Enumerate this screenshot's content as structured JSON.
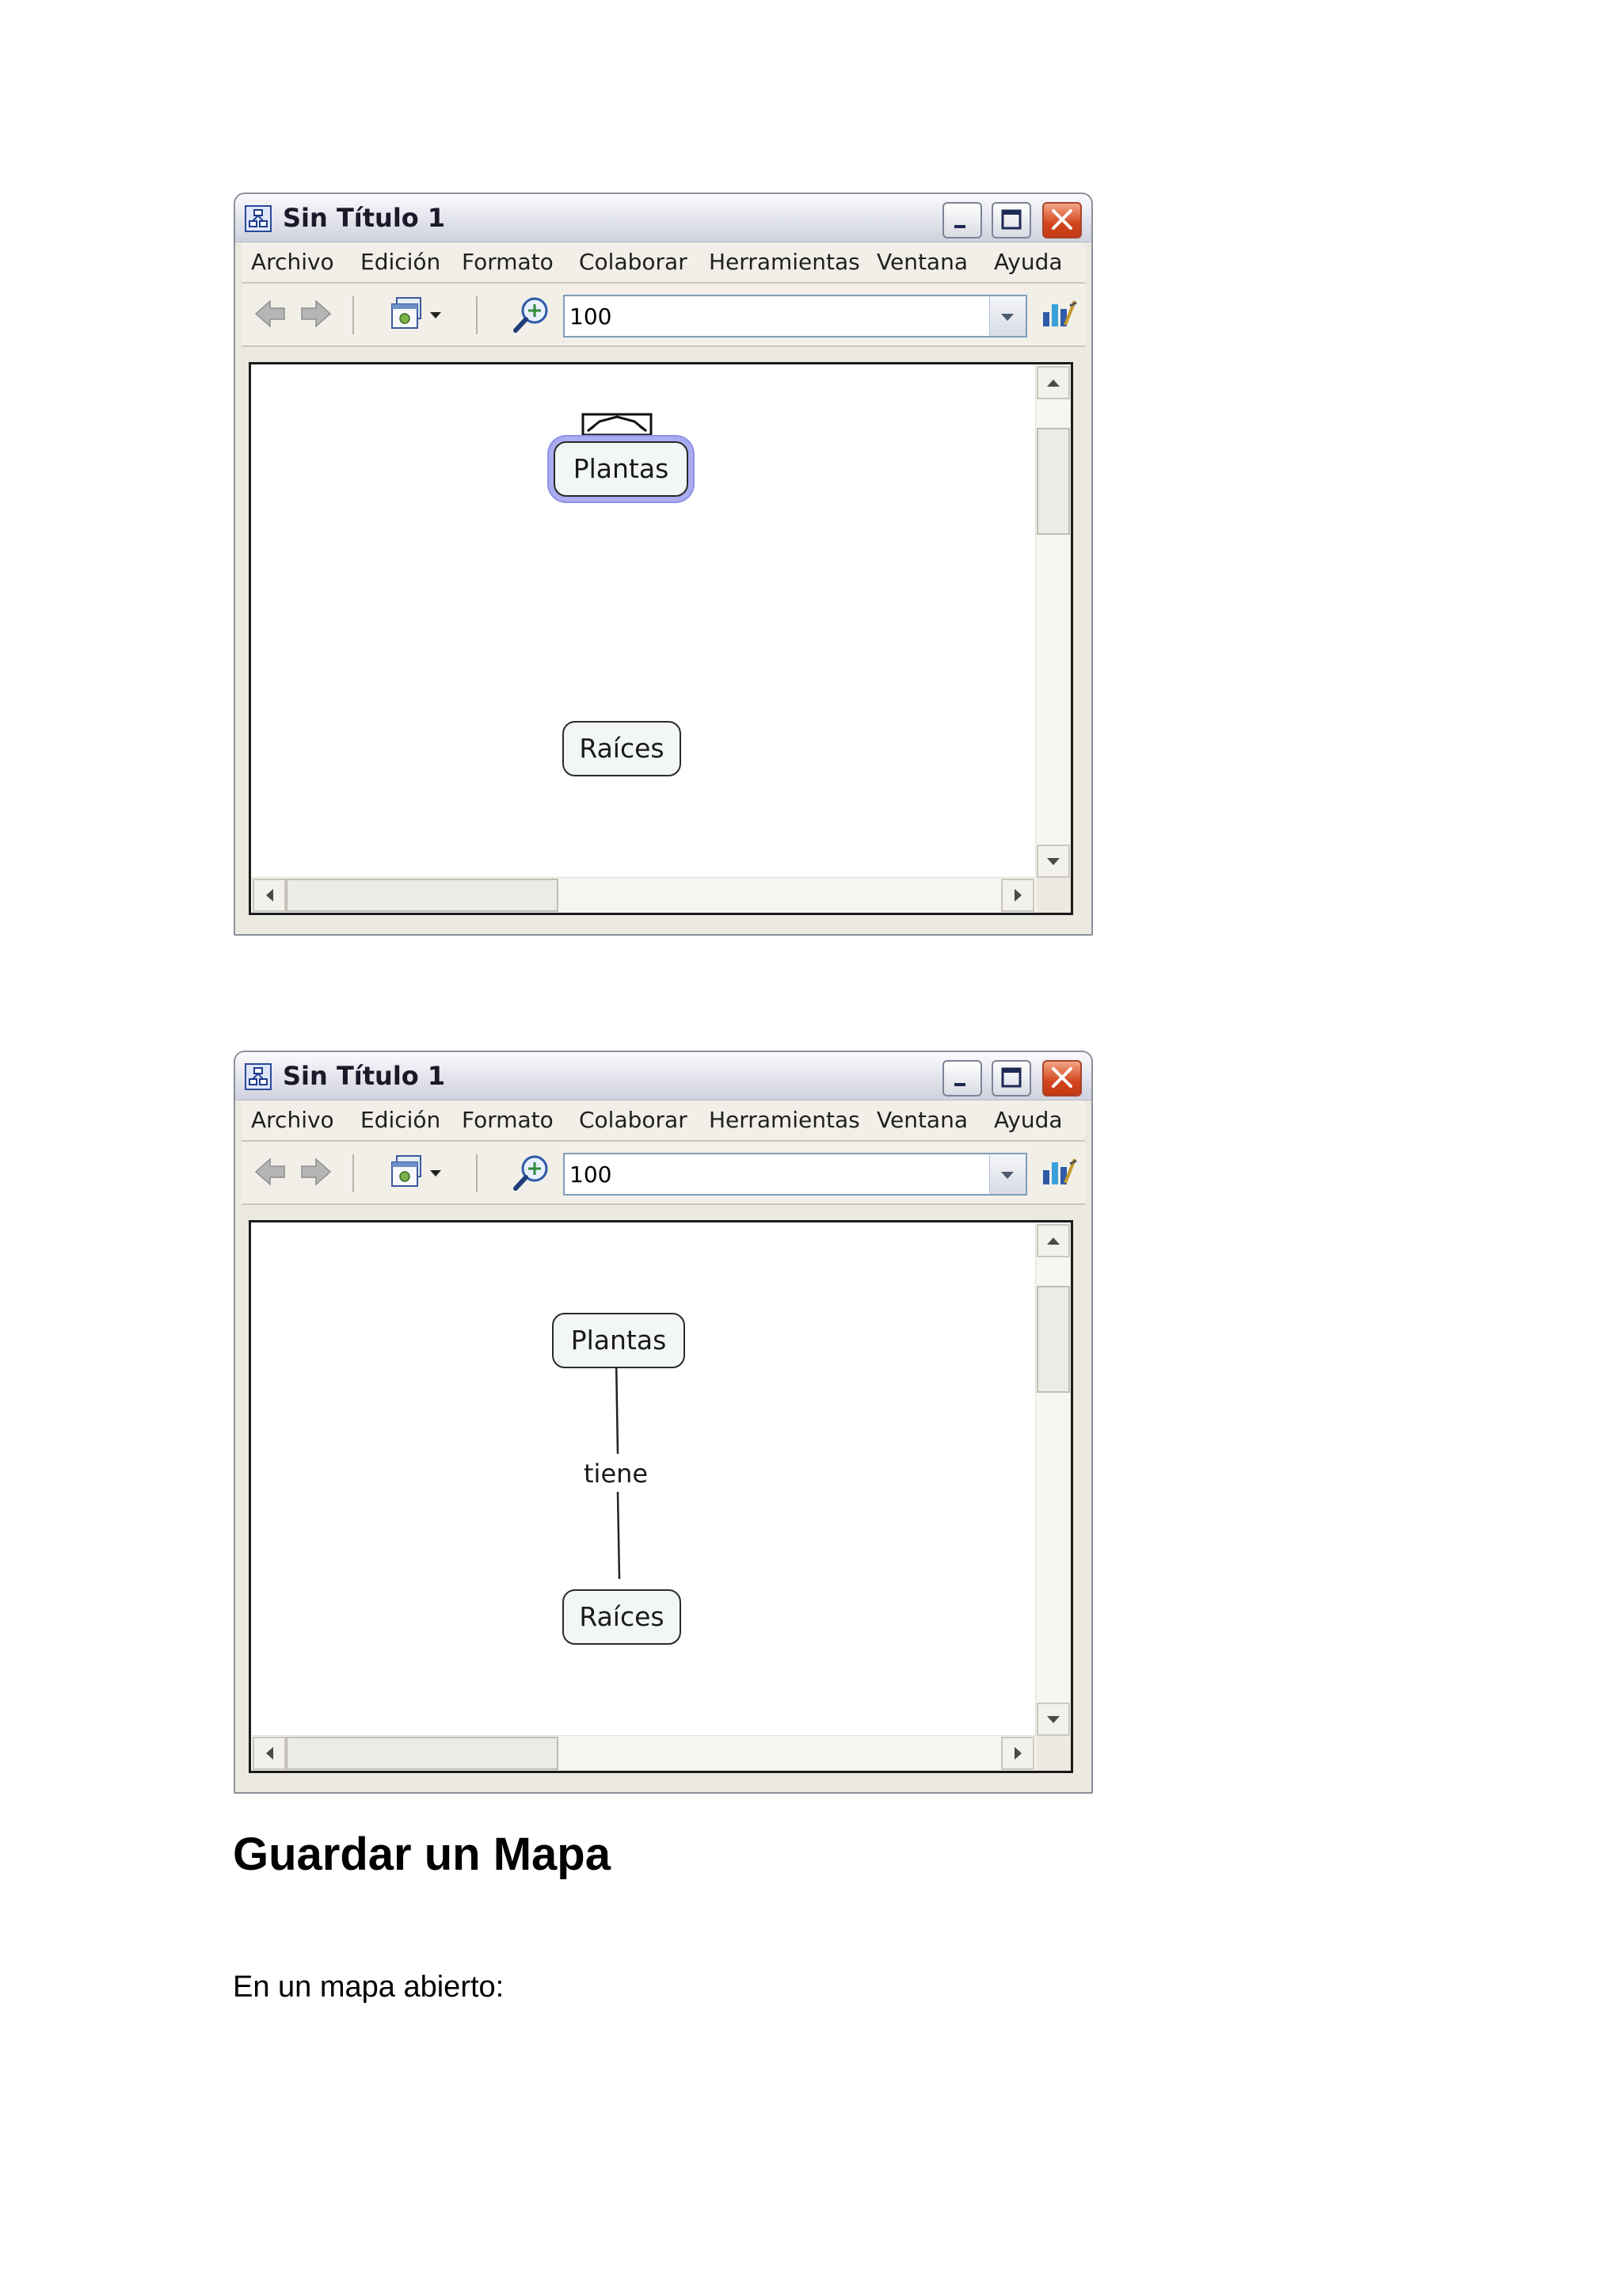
{
  "window": {
    "title": "Sin Título 1",
    "menu": [
      "Archivo",
      "Edición",
      "Formato",
      "Colaborar",
      "Herramientas",
      "Ventana",
      "Ayuda"
    ],
    "zoom_value": "100",
    "icons": {
      "app": "cmap-app-icon",
      "back": "back-arrow-icon",
      "forward": "forward-arrow-icon",
      "views": "views-dropdown-icon",
      "zoom": "zoom-magnifier-icon",
      "tools": "tools-icon"
    }
  },
  "screenshot1": {
    "nodes": {
      "top": "Plantas",
      "bottom": "Raíces"
    }
  },
  "screenshot2": {
    "nodes": {
      "top": "Plantas",
      "bottom": "Raíces"
    },
    "link_label": "tiene"
  },
  "section": {
    "heading": "Guardar un Mapa",
    "paragraph": "En un mapa abierto:"
  },
  "colors": {
    "selection_halo": "#a9acf0",
    "close_button": "#d2461e",
    "node_fill": "#f3f6f6"
  }
}
